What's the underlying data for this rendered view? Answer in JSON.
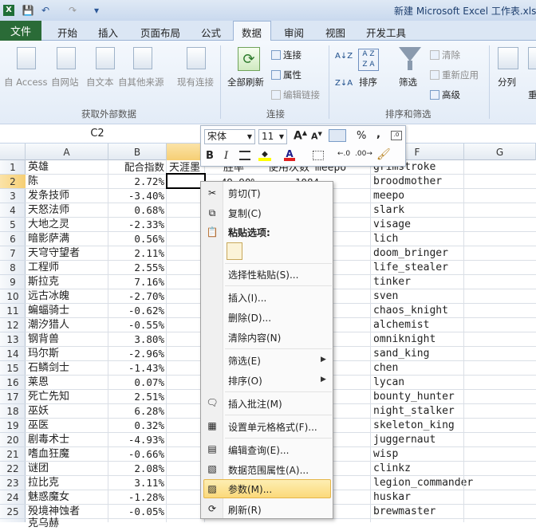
{
  "window": {
    "title": "新建 Microsoft Excel 工作表.xlsx"
  },
  "qat": {
    "save": "💾",
    "undo": "↶",
    "redo": "↷",
    "customize": "▾"
  },
  "tabs": {
    "file": "文件",
    "home": "开始",
    "insert": "插入",
    "layout": "页面布局",
    "formulas": "公式",
    "data": "数据",
    "review": "审阅",
    "view": "视图",
    "developer": "开发工具"
  },
  "ribbon": {
    "access": "自 Access",
    "web": "自网站",
    "text": "自文本",
    "other": "自其他来源",
    "existing": "现有连接",
    "group_external": "获取外部数据",
    "refresh_all": "全部刷新",
    "connections": "连接",
    "properties": "属性",
    "edit_links": "编辑链接",
    "group_connections": "连接",
    "sort_az": "A↓Z",
    "sort_za": "Z↓A",
    "sort": "排序",
    "filter": "筛选",
    "clear": "清除",
    "reapply": "重新应用",
    "advanced": "高级",
    "group_sort": "排序和筛选",
    "text_to_columns": "分列",
    "remove_dup": "重"
  },
  "formula_bar": {
    "name_box": "C2"
  },
  "columns": [
    "A",
    "B",
    "F",
    "G"
  ],
  "rows": [
    "1",
    "2",
    "3",
    "4",
    "5",
    "6",
    "7",
    "8",
    "9",
    "10",
    "11",
    "12",
    "13",
    "14",
    "15",
    "16",
    "17",
    "18",
    "19",
    "20",
    "21",
    "22",
    "23",
    "24",
    "25"
  ],
  "col_a": [
    "英雄",
    "陈",
    "发条技师",
    "天怒法师",
    "大地之灵",
    "暗影萨满",
    "天穹守望者",
    "工程师",
    "斯拉克",
    "远古冰魄",
    "蝙蝠骑士",
    "潮汐猎人",
    "钢背兽",
    "玛尔斯",
    "石鳞剑士",
    "莱恩",
    "死亡先知",
    "巫妖",
    "巫医",
    "剧毒术士",
    "嗜血狂魔",
    "谜团",
    "拉比克",
    "魅惑魔女",
    "殁境神蚀者"
  ],
  "col_b": [
    "配合指数",
    "2.72%",
    "-3.40%",
    "0.68%",
    "-2.33%",
    "0.56%",
    "2.11%",
    "2.55%",
    "7.16%",
    "-2.70%",
    "-0.62%",
    "-0.55%",
    "3.80%",
    "-2.96%",
    "-1.43%",
    "0.07%",
    "2.51%",
    "6.28%",
    "0.32%",
    "-4.93%",
    "-0.66%",
    "2.08%",
    "3.11%",
    "-1.28%",
    "-0.05%"
  ],
  "col_f": [
    "grimstroke",
    "broodmother",
    "meepo",
    "slark",
    "visage",
    "lich",
    "doom_bringer",
    "life_stealer",
    "tinker",
    "sven",
    "chaos_knight",
    "alchemist",
    "omniknight",
    "sand_king",
    "chen",
    "lycan",
    "bounty_hunter",
    "night_stalker",
    "skeleton_king",
    "juggernaut",
    "wisp",
    "clinkz",
    "legion_commander",
    "huskar",
    "brewmaster"
  ],
  "row26_a": "克乌赫",
  "partial_row1": {
    "c": "天涯墨",
    "d": "胜率",
    "e": "使用次数",
    "e2": "meepo"
  },
  "partial_row2": {
    "d": "49.90%",
    "e": "1084"
  },
  "minitoolbar": {
    "font": "宋体",
    "size": "11",
    "grow": "A",
    "shrink": "A",
    "percent": "%",
    "comma": ",",
    "bold": "B",
    "italic": "I"
  },
  "context_menu": {
    "cut": "剪切(T)",
    "copy": "复制(C)",
    "paste_options": "粘贴选项:",
    "paste_special": "选择性粘贴(S)...",
    "insert": "插入(I)...",
    "delete": "删除(D)...",
    "clear": "清除内容(N)",
    "filter": "筛选(E)",
    "sort": "排序(O)",
    "comment": "插入批注(M)",
    "format_cells": "设置单元格格式(F)...",
    "edit_query": "编辑查询(E)...",
    "range_props": "数据范围属性(A)...",
    "parameters": "参数(M)...",
    "refresh": "刷新(R)"
  }
}
